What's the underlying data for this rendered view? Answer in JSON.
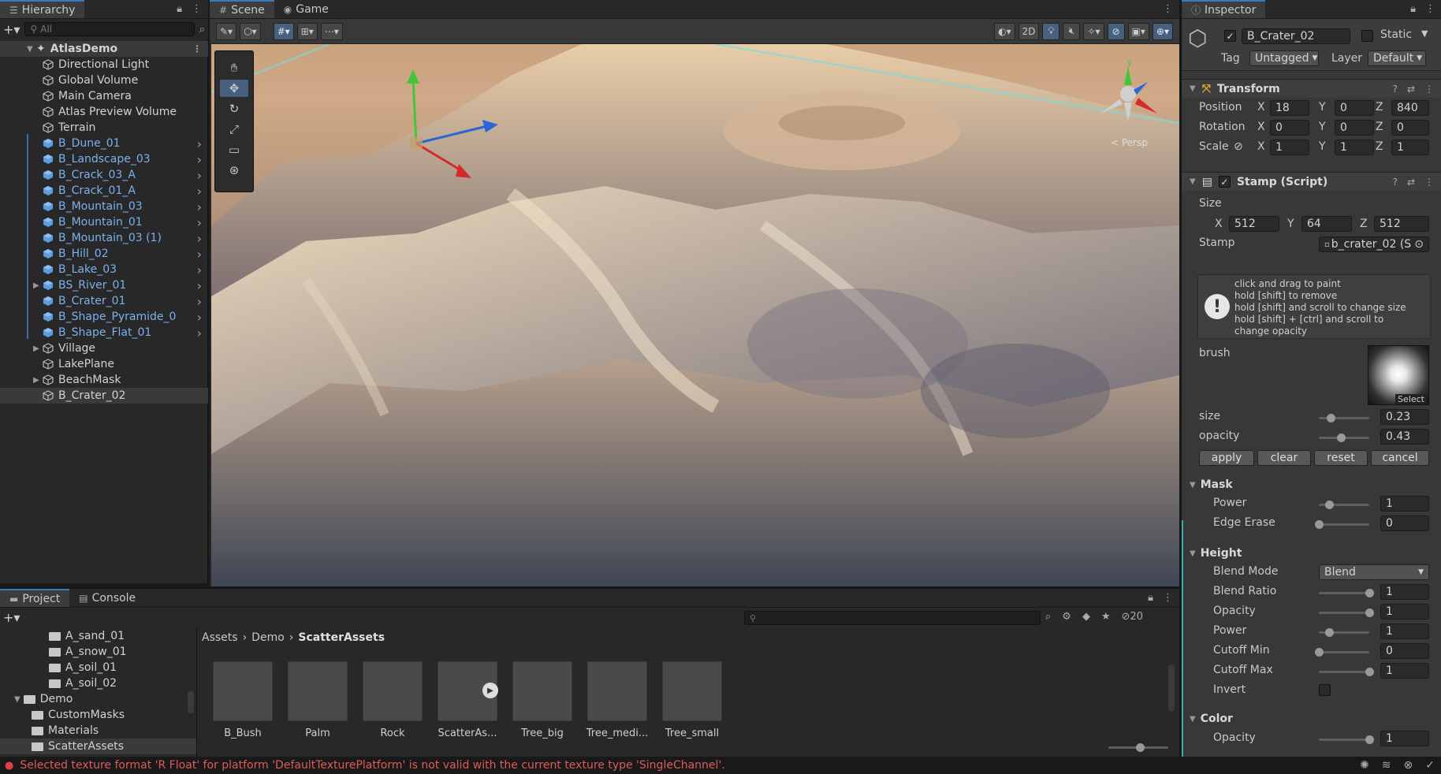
{
  "hierarchy": {
    "tab_label": "Hierarchy",
    "search_placeholder": "All",
    "root": "AtlasDemo",
    "items": [
      {
        "label": "Directional Light",
        "prefab": false,
        "expandable": false
      },
      {
        "label": "Global Volume",
        "prefab": false,
        "expandable": false
      },
      {
        "label": "Main Camera",
        "prefab": false,
        "expandable": false
      },
      {
        "label": "Atlas Preview Volume",
        "prefab": false,
        "expandable": false
      },
      {
        "label": "Terrain",
        "prefab": false,
        "expandable": false
      },
      {
        "label": "B_Dune_01",
        "prefab": true,
        "expandable": false
      },
      {
        "label": "B_Landscape_03",
        "prefab": true,
        "expandable": false
      },
      {
        "label": "B_Crack_03_A",
        "prefab": true,
        "expandable": false
      },
      {
        "label": "B_Crack_01_A",
        "prefab": true,
        "expandable": false
      },
      {
        "label": "B_Mountain_03",
        "prefab": true,
        "expandable": false
      },
      {
        "label": "B_Mountain_01",
        "prefab": true,
        "expandable": false
      },
      {
        "label": "B_Mountain_03 (1)",
        "prefab": true,
        "expandable": false
      },
      {
        "label": "B_Hill_02",
        "prefab": true,
        "expandable": false
      },
      {
        "label": "B_Lake_03",
        "prefab": true,
        "expandable": false
      },
      {
        "label": "BS_River_01",
        "prefab": true,
        "expandable": true
      },
      {
        "label": "B_Crater_01",
        "prefab": true,
        "expandable": false
      },
      {
        "label": "B_Shape_Pyramide_0",
        "prefab": true,
        "expandable": false
      },
      {
        "label": "B_Shape_Flat_01",
        "prefab": true,
        "expandable": false
      },
      {
        "label": "Village",
        "prefab": false,
        "expandable": true
      },
      {
        "label": "LakePlane",
        "prefab": false,
        "expandable": false
      },
      {
        "label": "BeachMask",
        "prefab": false,
        "expandable": true
      },
      {
        "label": "B_Crater_02",
        "prefab": false,
        "expandable": false,
        "selected": true
      }
    ]
  },
  "scene": {
    "tabs": [
      {
        "label": "Scene",
        "icon": "hash-icon"
      },
      {
        "label": "Game",
        "icon": "gamepad-icon"
      }
    ],
    "mode_2d": "2D",
    "persp_label": "< Persp"
  },
  "inspector": {
    "tab_label": "Inspector",
    "object_name": "B_Crater_02",
    "static_label": "Static",
    "tag_label": "Tag",
    "tag_value": "Untagged",
    "layer_label": "Layer",
    "layer_value": "Default",
    "transform": {
      "title": "Transform",
      "position_label": "Position",
      "rotation_label": "Rotation",
      "scale_label": "Scale",
      "position": {
        "x": "18",
        "y": "0",
        "z": "840"
      },
      "rotation": {
        "x": "0",
        "y": "0",
        "z": "0"
      },
      "scale": {
        "x": "1",
        "y": "1",
        "z": "1"
      }
    },
    "stamp": {
      "title": "Stamp (Script)",
      "size_label": "Size",
      "size": {
        "x": "512",
        "y": "64",
        "z": "512"
      },
      "stamp_label": "Stamp",
      "stamp_value": "b_crater_02 (S",
      "help_lines": [
        "click and drag to paint",
        "hold [shift] to remove",
        "hold [shift] and scroll to change size",
        "hold [shift] + [ctrl] and scroll to",
        "change opacity"
      ],
      "brush_label": "brush",
      "brush_select": "Select",
      "size_slider_label": "size",
      "size_slider_value": "0.23",
      "size_slider_fraction": 0.23,
      "opacity_slider_label": "opacity",
      "opacity_slider_value": "0.43",
      "opacity_slider_fraction": 0.43,
      "buttons": {
        "apply": "apply",
        "clear": "clear",
        "reset": "reset",
        "cancel": "cancel"
      }
    },
    "mask": {
      "title": "Mask",
      "power_label": "Power",
      "power_value": "1",
      "power_fraction": 0.2,
      "edge_erase_label": "Edge Erase",
      "edge_erase_value": "0",
      "edge_erase_fraction": 0.0
    },
    "height": {
      "title": "Height",
      "blend_mode_label": "Blend Mode",
      "blend_mode_value": "Blend",
      "blend_ratio_label": "Blend Ratio",
      "blend_ratio_value": "1",
      "opacity_label": "Opacity",
      "opacity_value": "1",
      "power_label": "Power",
      "power_value": "1",
      "cutoff_min_label": "Cutoff Min",
      "cutoff_min_value": "0",
      "cutoff_max_label": "Cutoff Max",
      "cutoff_max_value": "1",
      "invert_label": "Invert"
    },
    "color": {
      "title": "Color",
      "opacity_label": "Opacity",
      "opacity_value": "1"
    }
  },
  "project": {
    "tabs": [
      {
        "label": "Project",
        "icon": "folder-icon"
      },
      {
        "label": "Console",
        "icon": "console-icon"
      }
    ],
    "hidden_count": "20",
    "tree": [
      {
        "label": "A_sand_01",
        "indent": 3
      },
      {
        "label": "A_snow_01",
        "indent": 3
      },
      {
        "label": "A_soil_01",
        "indent": 3
      },
      {
        "label": "A_soil_02",
        "indent": 3
      },
      {
        "label": "Demo",
        "indent": 1,
        "expanded": true
      },
      {
        "label": "CustomMasks",
        "indent": 2
      },
      {
        "label": "Materials",
        "indent": 2
      },
      {
        "label": "ScatterAssets",
        "indent": 2,
        "selected": true
      }
    ],
    "breadcrumb": [
      "Assets",
      "Demo",
      "ScatterAssets"
    ],
    "assets": [
      "B_Bush",
      "Palm",
      "Rock",
      "ScatterAs...",
      "Tree_big",
      "Tree_medi...",
      "Tree_small"
    ]
  },
  "status": {
    "error_message": "Selected texture format 'R Float' for platform 'DefaultTexturePlatform' is not valid with the current texture type 'SingleChannel'."
  },
  "colors": {
    "accent": "#3a79bb",
    "prefab_text": "#7cb0ef",
    "error": "#e05a5a"
  }
}
